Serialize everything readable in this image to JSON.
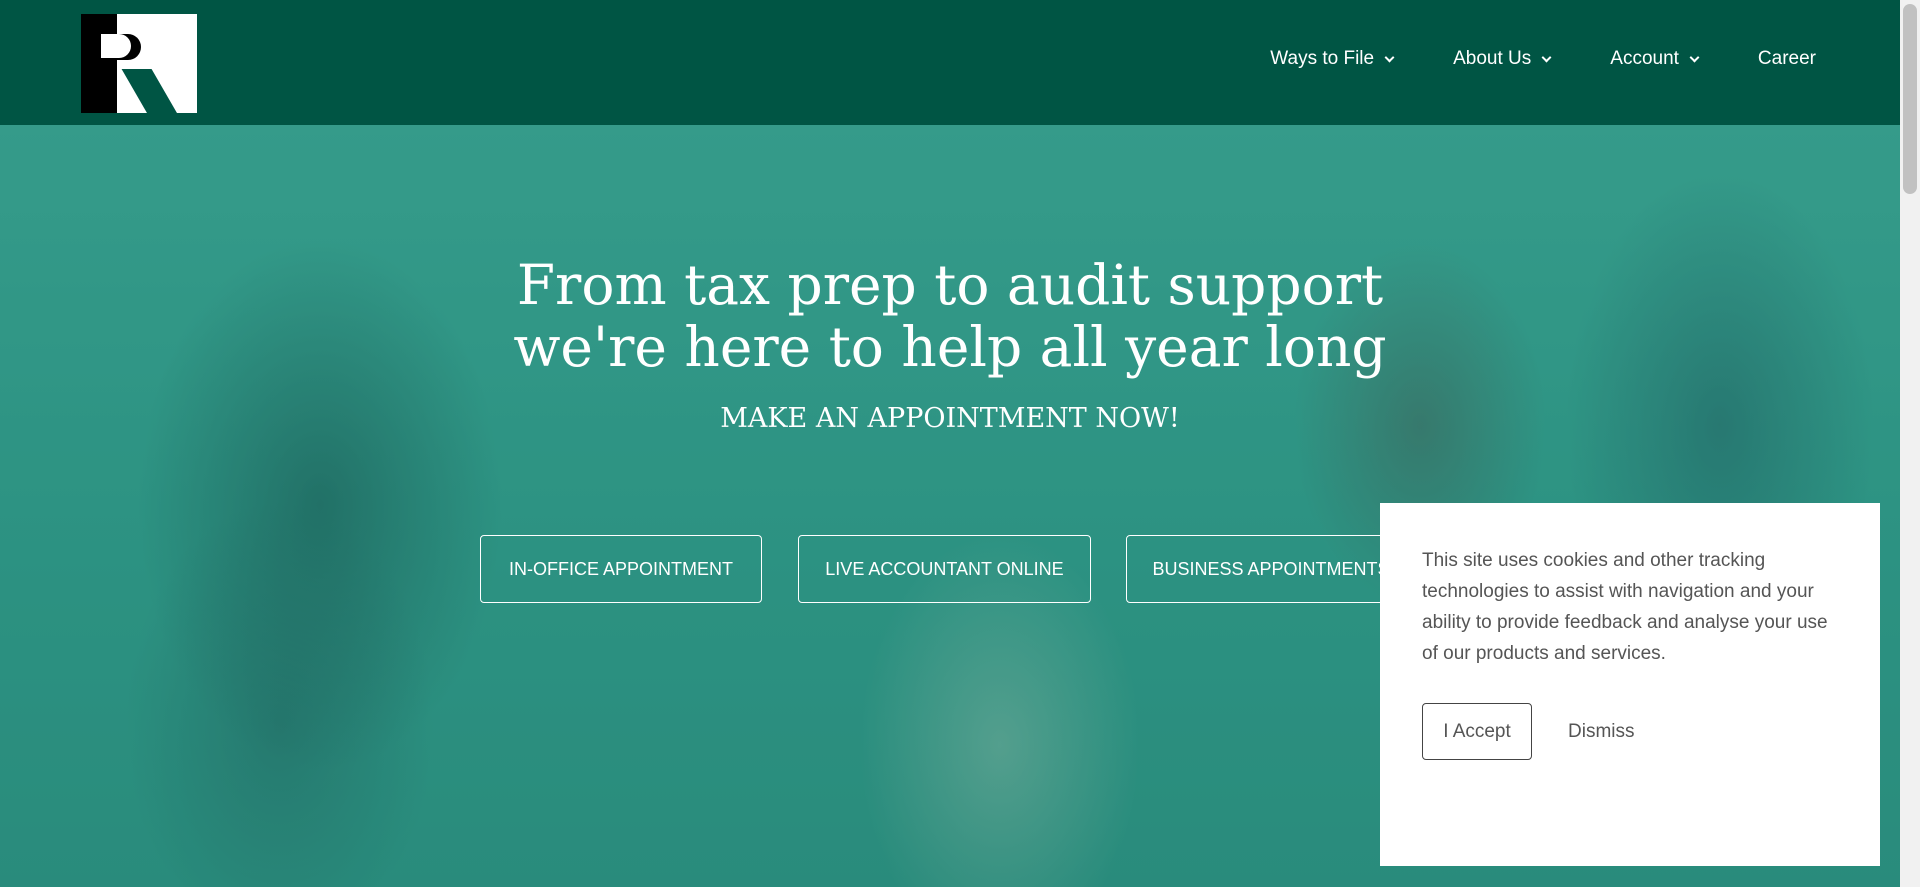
{
  "brand": {
    "logo_letters": "PR"
  },
  "nav": [
    {
      "label": "Ways to File",
      "has_dropdown": true
    },
    {
      "label": "About Us",
      "has_dropdown": true
    },
    {
      "label": "Account",
      "has_dropdown": true
    },
    {
      "label": "Career",
      "has_dropdown": false
    }
  ],
  "hero": {
    "title_line1": "From tax prep to audit support",
    "title_line2": "we're here to help all year long",
    "subtitle": "MAKE AN APPOINTMENT NOW!",
    "buttons": [
      {
        "label": "IN-OFFICE APPOINTMENT"
      },
      {
        "label": "LIVE ACCOUNTANT ONLINE"
      },
      {
        "label": "BUSINESS APPOINTMENTS"
      }
    ]
  },
  "cookie_banner": {
    "message": "This site uses cookies and other tracking technologies to assist with navigation and your ability to provide feedback and analyse your use of our products and services.",
    "accept_label": "I Accept",
    "dismiss_label": "Dismiss"
  },
  "colors": {
    "header_bg": "#005544",
    "hero_tint": "#2a8a7a",
    "text_light": "#ffffff"
  }
}
